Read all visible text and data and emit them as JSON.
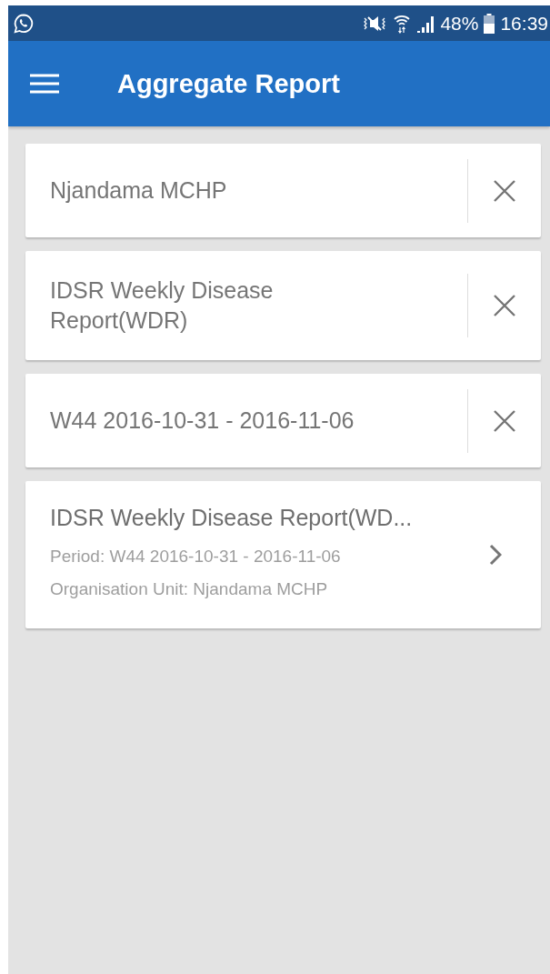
{
  "status_bar": {
    "battery": "48%",
    "time": "16:39"
  },
  "app_bar": {
    "title": "Aggregate Report"
  },
  "filters": [
    {
      "value": "Njandama MCHP"
    },
    {
      "value": "IDSR Weekly Disease Report(WDR)"
    },
    {
      "value": "W44 2016-10-31 - 2016-11-06"
    }
  ],
  "report": {
    "title": "IDSR Weekly Disease Report(WD...",
    "period": "Period: W44 2016-10-31 - 2016-11-06",
    "org_unit": "Organisation Unit: Njandama MCHP"
  }
}
